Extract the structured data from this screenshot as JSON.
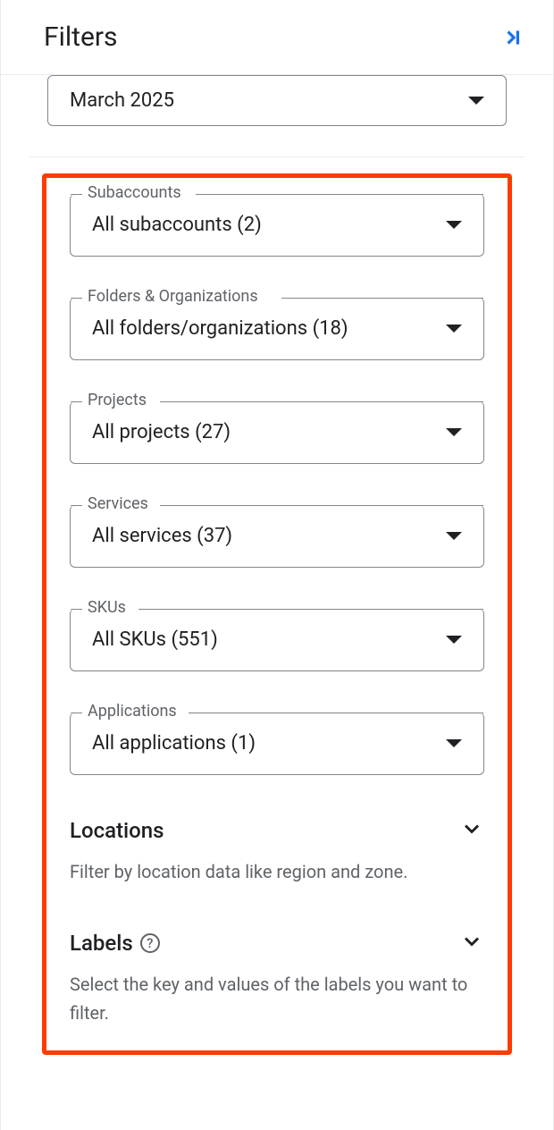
{
  "header": {
    "title": "Filters"
  },
  "date": {
    "value": "March 2025"
  },
  "filters": {
    "subaccounts": {
      "legend": "Subaccounts",
      "value": "All subaccounts (2)"
    },
    "folders": {
      "legend": "Folders & Organizations",
      "value": "All folders/organizations (18)"
    },
    "projects": {
      "legend": "Projects",
      "value": "All projects (27)"
    },
    "services": {
      "legend": "Services",
      "value": "All services (37)"
    },
    "skus": {
      "legend": "SKUs",
      "value": "All SKUs (551)"
    },
    "applications": {
      "legend": "Applications",
      "value": "All applications (1)"
    }
  },
  "locations": {
    "title": "Locations",
    "description": "Filter by location data like region and zone."
  },
  "labels": {
    "title": "Labels",
    "description": "Select the key and values of the labels you want to filter."
  }
}
